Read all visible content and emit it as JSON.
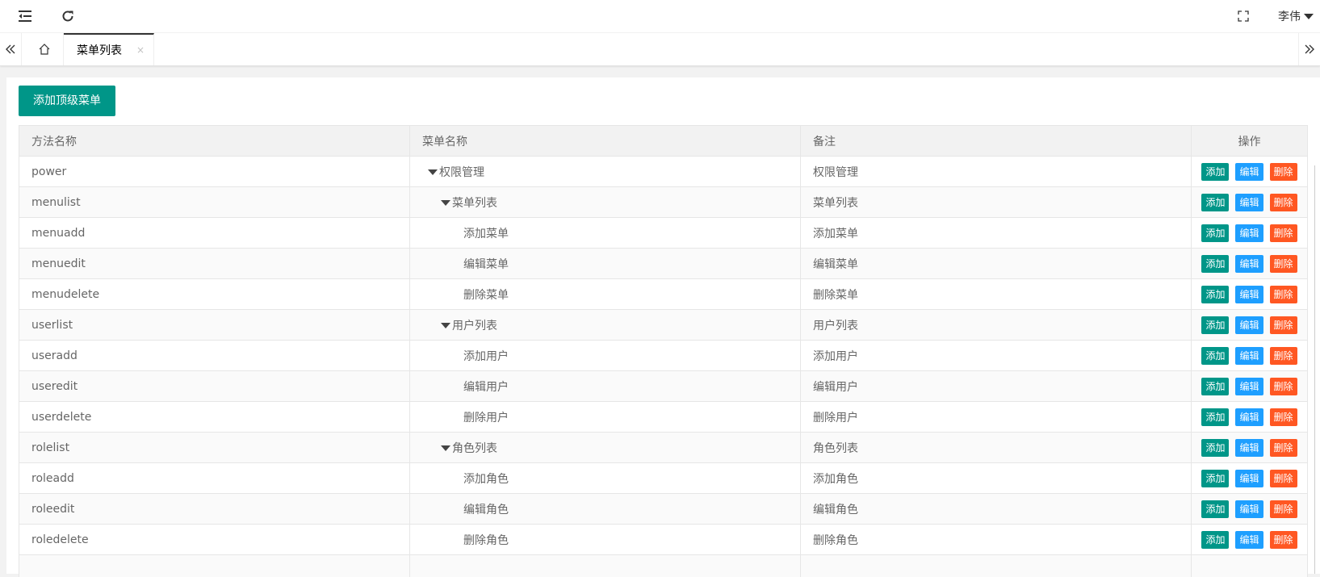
{
  "header": {
    "menu_icon": "menu-fold-icon",
    "refresh_icon": "refresh-icon",
    "fullscreen_icon": "fullscreen-icon",
    "user_name": "李伟"
  },
  "tabs": {
    "left_arrow_icon": "double-chevron-left-icon",
    "home_icon": "home-icon",
    "active_label": "菜单列表",
    "close_glyph": "×",
    "right_arrow_icon": "double-chevron-right-icon"
  },
  "toolbar": {
    "add_top_label": "添加顶级菜单"
  },
  "table": {
    "headers": [
      "方法名称",
      "菜单名称",
      "备注",
      "操作"
    ],
    "actions": {
      "add": "添加",
      "edit": "编辑",
      "delete": "删除"
    },
    "rows": [
      {
        "method": "power",
        "name": "权限管理",
        "note": "权限管理",
        "level": 1,
        "expanded": true
      },
      {
        "method": "menulist",
        "name": "菜单列表",
        "note": "菜单列表",
        "level": 2,
        "expanded": true
      },
      {
        "method": "menuadd",
        "name": "添加菜单",
        "note": "添加菜单",
        "level": 3,
        "expanded": false
      },
      {
        "method": "menuedit",
        "name": "编辑菜单",
        "note": "编辑菜单",
        "level": 3,
        "expanded": false
      },
      {
        "method": "menudelete",
        "name": "删除菜单",
        "note": "删除菜单",
        "level": 3,
        "expanded": false
      },
      {
        "method": "userlist",
        "name": "用户列表",
        "note": "用户列表",
        "level": 2,
        "expanded": true
      },
      {
        "method": "useradd",
        "name": "添加用户",
        "note": "添加用户",
        "level": 3,
        "expanded": false
      },
      {
        "method": "useredit",
        "name": "编辑用户",
        "note": "编辑用户",
        "level": 3,
        "expanded": false
      },
      {
        "method": "userdelete",
        "name": "删除用户",
        "note": "删除用户",
        "level": 3,
        "expanded": false
      },
      {
        "method": "rolelist",
        "name": "角色列表",
        "note": "角色列表",
        "level": 2,
        "expanded": true
      },
      {
        "method": "roleadd",
        "name": "添加角色",
        "note": "添加角色",
        "level": 3,
        "expanded": false
      },
      {
        "method": "roleedit",
        "name": "编辑角色",
        "note": "编辑角色",
        "level": 3,
        "expanded": false
      },
      {
        "method": "roledelete",
        "name": "删除角色",
        "note": "删除角色",
        "level": 3,
        "expanded": false
      },
      {
        "method": "",
        "name": "",
        "note": "",
        "level": 3,
        "expanded": false
      }
    ]
  },
  "colors": {
    "add": "#009688",
    "edit": "#1e9fff",
    "delete": "#ff5722"
  }
}
